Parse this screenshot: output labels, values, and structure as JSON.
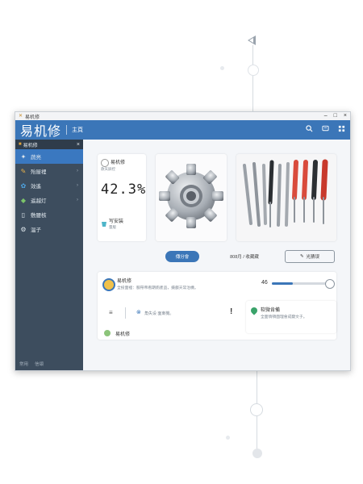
{
  "window": {
    "title": "易机修",
    "controls": [
      "–",
      "□",
      "×"
    ]
  },
  "header": {
    "brand": "易机修",
    "nav_home": "主頁"
  },
  "sidebar": {
    "title": "易机修",
    "close": "×",
    "items": [
      {
        "label": "蔬亮",
        "active": true,
        "icon": "sparkle-icon"
      },
      {
        "label": "殆屋裡",
        "icon": "wrench-icon"
      },
      {
        "label": "效遙",
        "icon": "gear-icon"
      },
      {
        "label": "遥越灯",
        "icon": "bulb-icon"
      },
      {
        "label": "敷腰核",
        "icon": "clipboard-icon"
      },
      {
        "label": "温子",
        "icon": "settings-icon"
      }
    ],
    "footer": [
      "常用",
      "信頌"
    ]
  },
  "stat_card": {
    "title": "易机修",
    "subtitle": "款天屏控",
    "value": "42.3%",
    "section_title": "写安装",
    "section_sub": "量版"
  },
  "actions": {
    "primary": "傳分會",
    "middle": "808月 / 收藏藏",
    "outline": "光猜误"
  },
  "list_card": {
    "title": "易机修",
    "description": "全投面裡：服帶帝看期廁產品，摄戲天常治機。",
    "slider_value": "46",
    "slider_fraction": 0.35,
    "row2_text": "角失设 面東機。",
    "bottom_title": "易机修",
    "bottom_title2": "易机修",
    "bottom_sub": "全投面裡"
  },
  "side_card": {
    "title": "软微肯備",
    "description": "全面情頓面理會成變文于。"
  },
  "colors": {
    "header": "#3b76b8",
    "sidebar": "#3d4d5e",
    "accent": "#3a78c0"
  }
}
